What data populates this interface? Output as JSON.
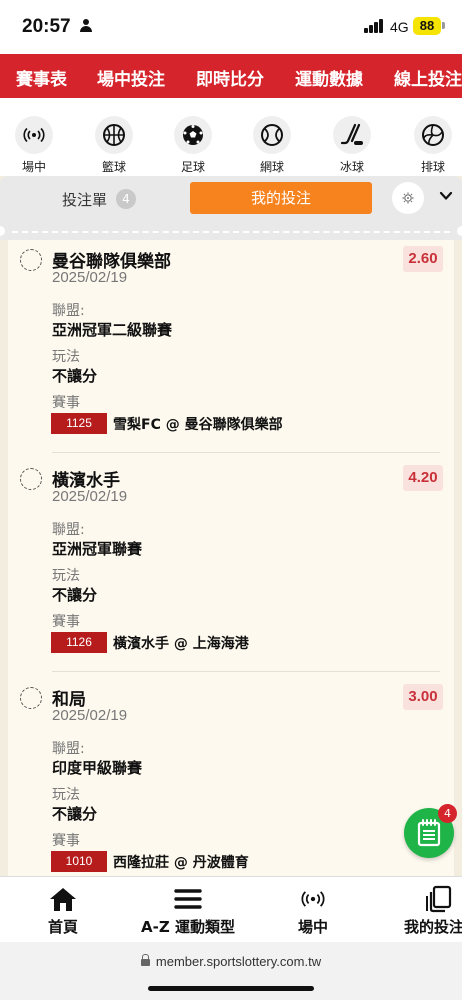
{
  "status_bar": {
    "time": "20:57",
    "network": "4G",
    "battery": "88"
  },
  "top_nav": {
    "items": [
      "賽事表",
      "場中投注",
      "即時比分",
      "運動數據",
      "線上投注"
    ]
  },
  "sports_nav": {
    "items": [
      {
        "label": "場中",
        "icon": "live-broadcast-icon"
      },
      {
        "label": "籃球",
        "icon": "basketball-icon"
      },
      {
        "label": "足球",
        "icon": "soccer-ball-icon"
      },
      {
        "label": "網球",
        "icon": "tennis-ball-icon"
      },
      {
        "label": "冰球",
        "icon": "ice-hockey-icon"
      },
      {
        "label": "排球",
        "icon": "volleyball-icon"
      }
    ]
  },
  "bet_header": {
    "slip_label": "投注單",
    "slip_count": "4",
    "my_bets_label": "我的投注"
  },
  "bets": [
    {
      "team": "曼谷聯隊俱樂部",
      "date": "2025/02/19",
      "odds": "2.60",
      "league_label": "聯盟:",
      "league": "亞洲冠軍二級聯賽",
      "play_label": "玩法",
      "play": "不讓分",
      "match_label": "賽事",
      "game_id": "1125",
      "match": "雪梨FC @ 曼谷聯隊俱樂部"
    },
    {
      "team": "橫濱水手",
      "date": "2025/02/19",
      "odds": "4.20",
      "league_label": "聯盟:",
      "league": "亞洲冠軍聯賽",
      "play_label": "玩法",
      "play": "不讓分",
      "match_label": "賽事",
      "game_id": "1126",
      "match": "橫濱水手 @ 上海海港"
    },
    {
      "team": "和局",
      "date": "2025/02/19",
      "odds": "3.00",
      "league_label": "聯盟:",
      "league": "印度甲級聯賽",
      "play_label": "玩法",
      "play": "不讓分",
      "match_label": "賽事",
      "game_id": "1010",
      "match": "西隆拉莊 @ 丹波體育"
    }
  ],
  "fab": {
    "badge": "4"
  },
  "bottom_nav": {
    "items": [
      {
        "label": "首頁",
        "icon": "home-icon"
      },
      {
        "label": "A-Z 運動類型",
        "icon": "menu-icon"
      },
      {
        "label": "場中",
        "icon": "live-broadcast-icon"
      },
      {
        "label": "我的投注",
        "icon": "copy-icon"
      }
    ]
  },
  "url": "member.sportslottery.com.tw",
  "colors": {
    "brand_red": "#d6242c",
    "orange": "#f7831f",
    "green": "#1fb447",
    "odds_red": "#c9313a"
  }
}
